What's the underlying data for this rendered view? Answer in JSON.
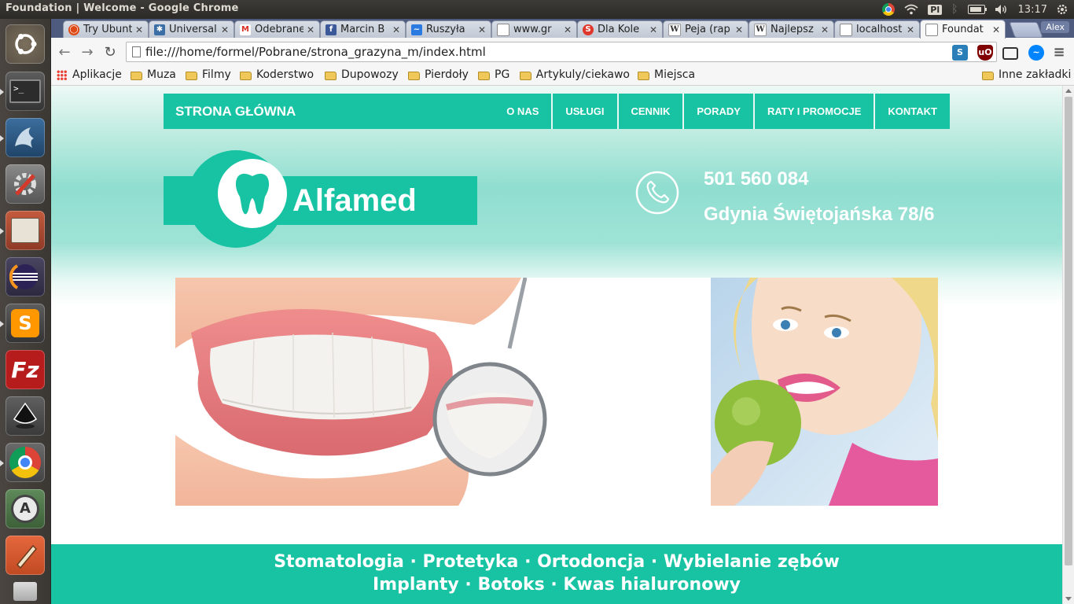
{
  "system": {
    "window_title": "Foundation | Welcome - Google Chrome",
    "keyboard_layout": "Pl",
    "clock": "13:17"
  },
  "launcher": {
    "apps": [
      "ubuntu-dash",
      "terminal",
      "mysql-workbench",
      "system-settings",
      "file-manager",
      "eclipse",
      "sublime-text",
      "filezilla",
      "inkscape",
      "chrome",
      "software-updater",
      "text-editor"
    ]
  },
  "browser": {
    "tabs": [
      {
        "label": "Try Ubuntu",
        "favicon": "ubuntu",
        "color": "#dd4814"
      },
      {
        "label": "Universal",
        "favicon": "generic",
        "color": "#3a6ea5"
      },
      {
        "label": "Odebrane",
        "favicon": "gmail",
        "color": "#d93025"
      },
      {
        "label": "Marcin B",
        "favicon": "facebook",
        "color": "#3b5998"
      },
      {
        "label": "Ruszyła",
        "favicon": "generic",
        "color": "#2a7ae2"
      },
      {
        "label": "www.gr",
        "favicon": "page",
        "color": "#999999"
      },
      {
        "label": "Dla Kole",
        "favicon": "s-icon",
        "color": "#e0372c"
      },
      {
        "label": "Peja (rap",
        "favicon": "wikipedia",
        "color": "#333333"
      },
      {
        "label": "Najlepsz",
        "favicon": "wikipedia",
        "color": "#333333"
      },
      {
        "label": "localhost",
        "favicon": "page",
        "color": "#999999"
      },
      {
        "label": "Foundat",
        "favicon": "page",
        "color": "#999999",
        "active": true
      }
    ],
    "profile_name": "Alex",
    "url": "file:///home/formel/Pobrane/strona_grazyna_m/index.html",
    "bookmarks": [
      {
        "label": "Aplikacje",
        "type": "apps"
      },
      {
        "label": "Muza",
        "type": "folder"
      },
      {
        "label": "Filmy",
        "type": "folder"
      },
      {
        "label": "Koderstwo",
        "type": "folder"
      },
      {
        "label": "Dupowozy",
        "type": "folder"
      },
      {
        "label": "Pierdoły",
        "type": "folder"
      },
      {
        "label": "PG",
        "type": "folder"
      },
      {
        "label": "Artykuly/ciekawo",
        "type": "folder"
      },
      {
        "label": "Miejsca",
        "type": "folder"
      }
    ],
    "other_bookmarks": "Inne zakładki"
  },
  "site": {
    "brand": "STRONA GŁÓWNA",
    "menu": [
      "O NAS",
      "USŁUGI",
      "CENNIK",
      "PORADY",
      "RATY I PROMOCJE",
      "KONTAKT"
    ],
    "logo_text": "Alfamed",
    "phone": "501 560 084",
    "address": "Gdynia Świętojańska 78/6",
    "services_line1": "Stomatologia · Protetyka · Ortodoncja · Wybielanie zębów",
    "services_line2": "Implanty · Botoks · Kwas hialuronowy",
    "accent_color": "#17c3a2"
  }
}
